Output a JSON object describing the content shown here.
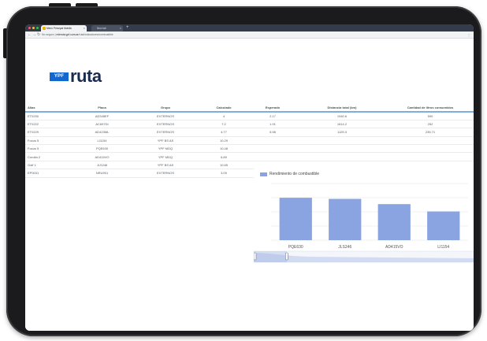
{
  "browser": {
    "tabs": [
      {
        "label": "Menú Principal Mobilis",
        "active": true
      },
      {
        "label": "New tab",
        "active": false
      }
    ],
    "url_prefix": "No seguro",
    "url_host": "mieruta.ypf.com.ar",
    "url_path": "/ruta/indicadores/combustible",
    "window_dot_colors": [
      "#ff5f57",
      "#febc2e",
      "#28c840"
    ]
  },
  "logo": {
    "badge": "YPF",
    "wordmark": "ruta",
    "badge_color": "#1268cf",
    "wordmark_color": "#1a2b4d"
  },
  "table": {
    "columns": [
      "Alias",
      "Placa",
      "Grupo",
      "Calculado",
      "Esperado",
      "Distancia total (km)",
      "Cantidad de litros consumidos"
    ],
    "rows": [
      [
        "ET0230",
        "AD345EF",
        "EXTERNOS",
        "4",
        "2.17",
        "1940.6",
        "590"
      ],
      [
        "ET0222",
        "AC697DI",
        "EXTERNOS",
        "7.2",
        "1.91",
        "1614.2",
        "252"
      ],
      [
        "ET0229",
        "AD423ML",
        "EXTERNOS",
        "4.77",
        "5.98",
        "1125.3",
        "235.71"
      ],
      [
        "Focus 5",
        "LI1154",
        "YPF BS AS",
        "10.29",
        "",
        "",
        ""
      ],
      [
        "Focus 5",
        "PQE630",
        "YPF MDQ",
        "10.48",
        "",
        "",
        ""
      ],
      [
        "Corolla 2",
        "AD415VO",
        "YPF MDQ",
        "6.89",
        "",
        "",
        ""
      ],
      [
        "Golf 1",
        "JLS246",
        "YPF BS AS",
        "10.65",
        "",
        "",
        ""
      ],
      [
        "EP0031",
        "NRU901",
        "EXTERNOS",
        "3.09",
        "",
        "",
        ""
      ]
    ]
  },
  "chart_data": {
    "type": "bar",
    "series": [
      {
        "name": "Rendimiento de combustible",
        "values": [
          10.48,
          10.2,
          8.9,
          7.1
        ]
      }
    ],
    "categories": [
      "PQE630",
      "JLS246",
      "AD415VO",
      "LI1154"
    ],
    "ylim": [
      0,
      14
    ],
    "bar_color": "#8aa4e2",
    "legend_position": "top-left",
    "grid": true,
    "zoom_slider": {
      "start": 0.0,
      "end": 0.15
    }
  }
}
